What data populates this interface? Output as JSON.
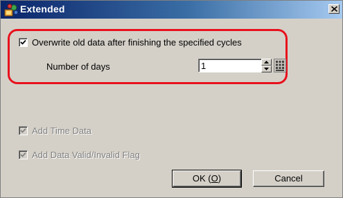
{
  "window": {
    "title": "Extended",
    "title_icon": "app-extended-icon",
    "close_icon": "close-icon"
  },
  "overwrite": {
    "label": "Overwrite old data after finishing the specified cycles",
    "checked": true
  },
  "days": {
    "label": "Number of days",
    "value": "1"
  },
  "add_time": {
    "label": "Add Time Data",
    "checked": true,
    "disabled": true
  },
  "add_flag": {
    "label": "Add Data Valid/Invalid Flag",
    "checked": true,
    "disabled": true
  },
  "buttons": {
    "ok_prefix": "OK (",
    "ok_key": "O",
    "ok_suffix": ")",
    "cancel": "Cancel"
  },
  "colors": {
    "highlight": "#e8101c",
    "titlebar_start": "#0a246a",
    "titlebar_end": "#a6caf0",
    "dialog_bg": "#d4d0c8"
  }
}
